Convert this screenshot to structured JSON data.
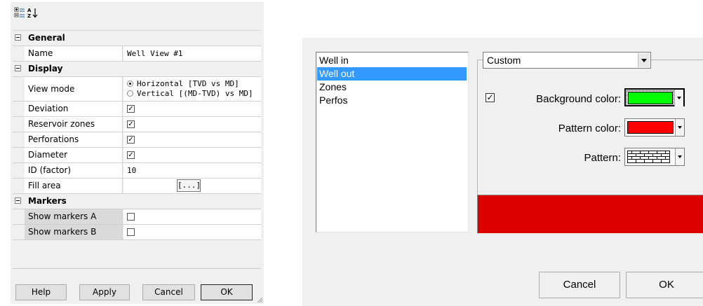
{
  "property_grid": {
    "categories": {
      "general": "General",
      "display": "Display",
      "markers": "Markers"
    },
    "rows": {
      "name": {
        "label": "Name",
        "value": "Well View #1"
      },
      "view_mode": {
        "label": "View mode",
        "option1": "Horizontal [TVD vs MD]",
        "option2": "Vertical [(MD-TVD) vs MD]"
      },
      "deviation": {
        "label": "Deviation",
        "checked": true
      },
      "reservoir_zones": {
        "label": "Reservoir zones",
        "checked": true
      },
      "perforations": {
        "label": "Perforations",
        "checked": true
      },
      "diameter": {
        "label": "Diameter",
        "checked": true
      },
      "id_factor": {
        "label": "ID (factor)",
        "value": "10"
      },
      "fill_area": {
        "label": "Fill area",
        "button": "[...]"
      },
      "show_markers_a": {
        "label": "Show markers A",
        "checked": false
      },
      "show_markers_b": {
        "label": "Show markers B",
        "checked": false
      }
    },
    "check_glyph": "✓",
    "buttons": {
      "help": "Help",
      "apply": "Apply",
      "cancel": "Cancel",
      "ok": "OK"
    }
  },
  "style_dialog": {
    "list_items": [
      "Well in",
      "Well out",
      "Zones",
      "Perfos"
    ],
    "selected_item": "Well out",
    "combo_value": "Custom",
    "background_label": "Background color:",
    "pattern_color_label": "Pattern color:",
    "pattern_label": "Pattern:",
    "check_glyph": "✓",
    "colors": {
      "background": "#00ff00",
      "pattern": "#ff0000",
      "selection": "#3399ff"
    },
    "buttons": {
      "cancel": "Cancel",
      "ok": "OK"
    }
  }
}
